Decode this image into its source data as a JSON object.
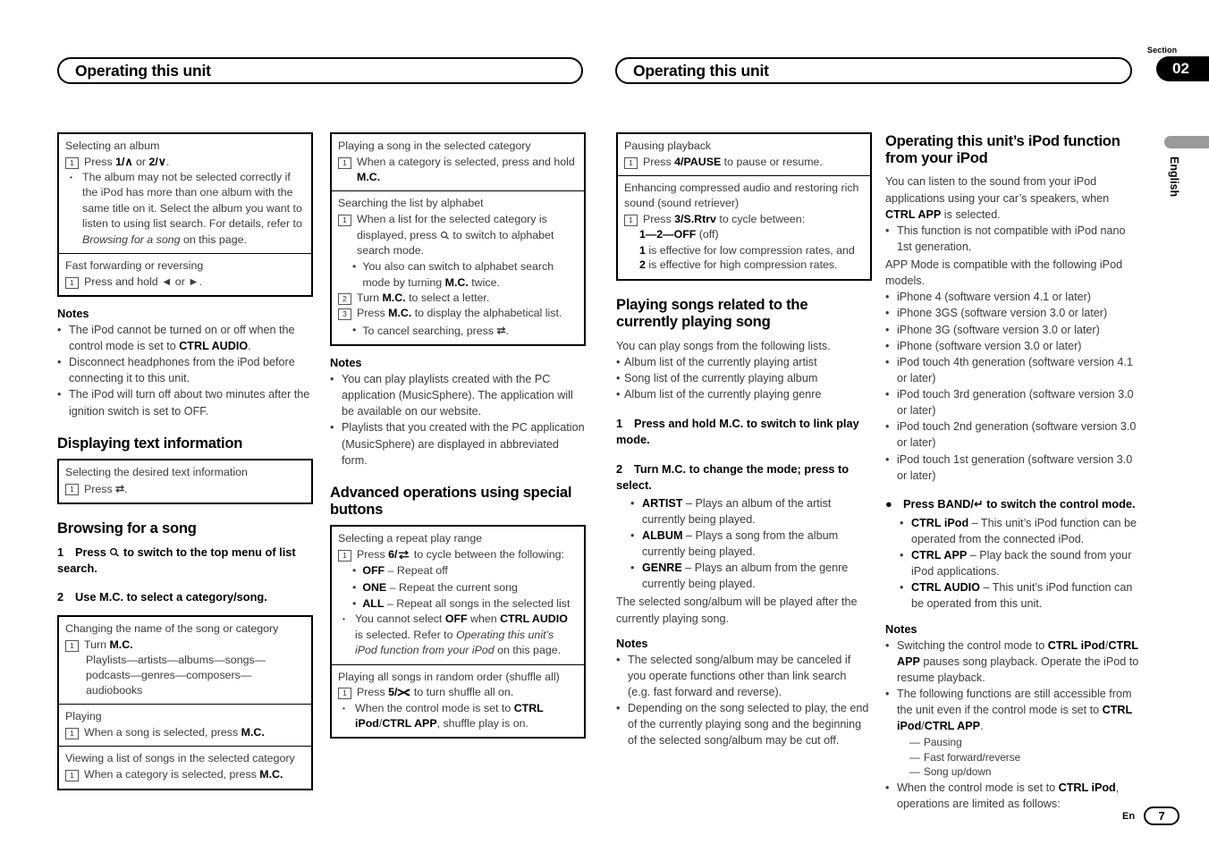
{
  "page": {
    "header_left": "Operating this unit",
    "header_right": "Operating this unit",
    "section_label": "Section",
    "section_number": "02",
    "side_tab_language": "English",
    "footer_lang": "En",
    "footer_page": "7"
  },
  "col1": {
    "box1": {
      "row1": {
        "title": "Selecting an album",
        "step1_num": "1",
        "step1_text_a": "Press ",
        "step1_b1": "1/∧",
        "step1_mid": " or ",
        "step1_b2": "2/∨",
        "step1_end": ".",
        "bullet": "The album may not be selected correctly if the iPod has more than one album with the same title on it. Select the album you want to listen to using list search. For details, refer to ",
        "bullet_italic": "Browsing for a song",
        "bullet_end": " on this page."
      },
      "row2": {
        "title": "Fast forwarding or reversing",
        "step1_num": "1",
        "step1_text": "Press and hold ◄ or ►."
      }
    },
    "notes_heading": "Notes",
    "notes": [
      {
        "pre": "The iPod cannot be turned on or off when the control mode is set to ",
        "bold": "CTRL AUDIO",
        "post": "."
      },
      {
        "pre": "Disconnect headphones from the iPod before connecting it to this unit.",
        "bold": "",
        "post": ""
      },
      {
        "pre": "The iPod will turn off about two minutes after the ignition switch is set to OFF.",
        "bold": "",
        "post": ""
      }
    ],
    "heading_display_text": "Displaying text information",
    "box2": {
      "title": "Selecting the desired text information",
      "step1_num": "1",
      "step1_text": "Press",
      "step1_icon": "back-arrow-icon"
    },
    "heading_browsing": "Browsing for a song",
    "step1_num": "1",
    "step1_pre": "Press",
    "step1_icon": "search-icon",
    "step1_post": "to switch to the top menu of list search.",
    "step2_num": "2",
    "step2_text": "Use M.C. to select a category/song.",
    "box3": {
      "row1": {
        "title": "Changing the name of the song or category",
        "step1_num": "1",
        "step1_pre": "Turn ",
        "step1_bold": "M.C.",
        "chain": "Playlists—artists—albums—songs—podcasts—genres—composers—audiobooks"
      },
      "row2": {
        "title": "Playing",
        "step1_num": "1",
        "step1_pre": "When a song is selected, press ",
        "step1_bold": "M.C."
      },
      "row3": {
        "title": "Viewing a list of songs in the selected category",
        "step1_num": "1",
        "step1_pre": "When a category is selected, press ",
        "step1_bold": "M.C."
      }
    }
  },
  "col2": {
    "box1": {
      "row1": {
        "title": "Playing a song in the selected category",
        "step1_num": "1",
        "step1_pre": "When a category is selected, press and hold ",
        "step1_bold": "M.C."
      },
      "row2": {
        "title": "Searching the list by alphabet",
        "step1_num": "1",
        "step1_pre": "When a list for the selected category is displayed, press ",
        "step1_icon": "search-icon",
        "step1_post": " to switch to alphabet search mode.",
        "sub1_pre": "You also can switch to alphabet search mode by turning ",
        "sub1_bold": "M.C.",
        "sub1_post": " twice.",
        "step2_num": "2",
        "step2_pre": "Turn ",
        "step2_bold": "M.C.",
        "step2_post": " to select a letter.",
        "step3_num": "3",
        "step3_pre": "Press ",
        "step3_bold": "M.C.",
        "step3_post": " to display the alphabetical list.",
        "sub2_pre": "To cancel searching, press ",
        "sub2_icon": "back-arrow-icon",
        "sub2_post": "."
      }
    },
    "notes_heading": "Notes",
    "notes": [
      "You can play playlists created with the PC application (MusicSphere). The application will be available on our website.",
      "Playlists that you created with the PC application (MusicSphere) are displayed in abbreviated form."
    ],
    "heading_advanced": "Advanced operations using special buttons",
    "box2": {
      "row1": {
        "title": "Selecting a repeat play range",
        "step1_num": "1",
        "step1_pre": "Press ",
        "step1_bold": "6/",
        "step1_icon": "repeat-icon",
        "step1_post": " to cycle between the following:",
        "options": [
          {
            "bold": "OFF",
            "text": " – Repeat off"
          },
          {
            "bold": "ONE",
            "text": " – Repeat the current song"
          },
          {
            "bold": "ALL",
            "text": " – Repeat all songs in the selected list"
          }
        ],
        "note_pre": "You cannot select ",
        "note_b1": "OFF",
        "note_mid": " when ",
        "note_b2": "CTRL AUDIO",
        "note_mid2": " is selected. Refer to ",
        "note_italic": "Operating this unit’s iPod function from your iPod",
        "note_end": " on this page."
      },
      "row2": {
        "title": "Playing all songs in random order (shuffle all)",
        "step1_num": "1",
        "step1_pre": "Press ",
        "step1_bold": "5/",
        "step1_icon": "shuffle-icon",
        "step1_post": " to turn shuffle all on.",
        "bullet_pre": "When the control mode is set to ",
        "bullet_b1": "CTRL iPod",
        "bullet_slash": "/",
        "bullet_b2": "CTRL APP",
        "bullet_post": ", shuffle play is on."
      }
    }
  },
  "col3": {
    "box1": {
      "row1": {
        "title": "Pausing playback",
        "step1_num": "1",
        "step1_pre": "Press ",
        "step1_bold": "4/PAUSE",
        "step1_post": " to pause or resume."
      },
      "row2": {
        "title": "Enhancing compressed audio and restoring rich sound (sound retriever)",
        "step1_num": "1",
        "step1_pre": "Press ",
        "step1_bold": "3/S.Rtrv",
        "step1_post": " to cycle between:",
        "cycle_bold": "1—2—OFF",
        "cycle_rest": " (off)",
        "desc_b1": "1",
        "desc_mid": " is effective for low compression rates, and ",
        "desc_b2": "2",
        "desc_end": " is effective for high compression rates."
      }
    },
    "heading_playing": "Playing songs related to the currently playing song",
    "intro": "You can play songs from the following lists.",
    "lists": [
      "Album list of the currently playing artist",
      "Song list of the currently playing album",
      "Album list of the currently playing genre"
    ],
    "step1_num": "1",
    "step1_text": "Press and hold M.C. to switch to link play mode.",
    "step2_num": "2",
    "step2_text": "Turn M.C. to change the mode; press to select.",
    "modes": [
      {
        "bold": "ARTIST",
        "text": " – Plays an album of the artist currently being played."
      },
      {
        "bold": "ALBUM",
        "text": " – Plays a song from the album currently being played."
      },
      {
        "bold": "GENRE",
        "text": " – Plays an album from the genre currently being played."
      }
    ],
    "after_text": "The selected song/album will be played after the currently playing song.",
    "notes_heading": "Notes",
    "notes": [
      "The selected song/album may be canceled if you operate functions other than link search (e.g. fast forward and reverse).",
      "Depending on the song selected to play, the end of the currently playing song and the beginning of the selected song/album may be cut off."
    ]
  },
  "col4": {
    "heading": "Operating this unit’s iPod function from your iPod",
    "intro_pre": "You can listen to the sound from your iPod applications using your car’s speakers, when ",
    "intro_bold": "CTRL APP",
    "intro_post": " is selected.",
    "bullet_nano": "This function is not compatible with iPod nano 1st generation.",
    "app_mode_text": "APP Mode is compatible with the following iPod models.",
    "models": [
      "iPhone 4 (software version 4.1 or later)",
      "iPhone 3GS (software version 3.0 or later)",
      "iPhone 3G (software version 3.0 or later)",
      "iPhone (software version 3.0 or later)",
      "iPod touch 4th generation (software version 4.1 or later)",
      "iPod touch 3rd generation (software version 3.0 or later)",
      "iPod touch 2nd generation (software version 3.0 or later)",
      "iPod touch 1st generation (software version 3.0 or later)"
    ],
    "band_step_pre": "Press BAND/",
    "band_step_icon": "band-return-icon",
    "band_step_post": " to switch the control mode.",
    "ctrl_modes": [
      {
        "bold": "CTRL iPod",
        "text": " – This unit’s iPod function can be operated from the connected iPod."
      },
      {
        "bold": "CTRL APP",
        "text": " – Play back the sound from your iPod applications."
      },
      {
        "bold": "CTRL AUDIO",
        "text": " – This unit’s iPod function can be operated from this unit."
      }
    ],
    "notes_heading": "Notes",
    "note1_pre": "Switching the control mode to ",
    "note1_b1": "CTRL iPod",
    "note1_slash": "/",
    "note1_b2": "CTRL APP",
    "note1_post": " pauses song playback. Operate the iPod to resume playback.",
    "note2_pre": "The following functions are still accessible from the unit even if the control mode is set to ",
    "note2_b1": "CTRL iPod",
    "note2_slash": "/",
    "note2_b2": "CTRL APP",
    "note2_post": ".",
    "note2_sub": [
      "Pausing",
      "Fast forward/reverse",
      "Song up/down"
    ],
    "note3_pre": "When the control mode is set to ",
    "note3_bold": "CTRL iPod",
    "note3_post": ", operations are limited as follows:"
  }
}
